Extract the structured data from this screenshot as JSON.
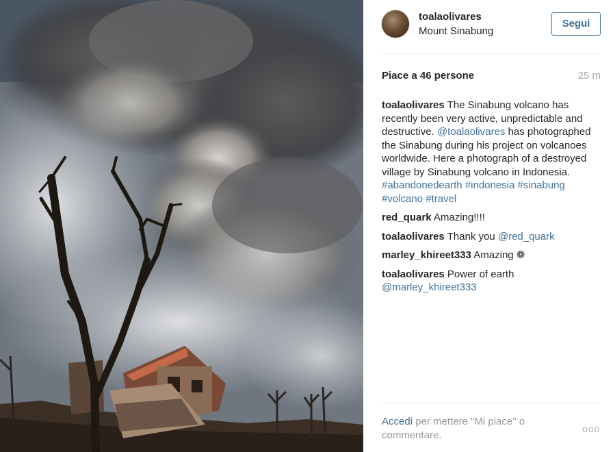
{
  "post": {
    "username": "toalaolivares",
    "location": "Mount Sinabung",
    "follow_label": "Segui",
    "likes": "Piace a 46 persone",
    "time": "25 m"
  },
  "comments": [
    {
      "user": "toalaolivares",
      "parts": [
        {
          "t": "text",
          "v": "The Sinabung volcano has recently been very active, unpredictable and destructive. "
        },
        {
          "t": "link",
          "v": "@toalaolivares"
        },
        {
          "t": "text",
          "v": " has photographed the Sinabung during his project on volcanoes worldwide. Here a photograph of a destroyed village by Sinabung volcano in Indonesia. "
        },
        {
          "t": "link",
          "v": "#abandonedearth"
        },
        {
          "t": "text",
          "v": " "
        },
        {
          "t": "link",
          "v": "#indonesia"
        },
        {
          "t": "text",
          "v": " "
        },
        {
          "t": "link",
          "v": "#sinabung"
        },
        {
          "t": "text",
          "v": " "
        },
        {
          "t": "link",
          "v": "#volcano"
        },
        {
          "t": "text",
          "v": " "
        },
        {
          "t": "link",
          "v": "#travel"
        }
      ]
    },
    {
      "user": "red_quark",
      "parts": [
        {
          "t": "text",
          "v": "Amazing!!!!"
        }
      ]
    },
    {
      "user": "toalaolivares",
      "parts": [
        {
          "t": "text",
          "v": "Thank you "
        },
        {
          "t": "link",
          "v": "@red_quark"
        }
      ]
    },
    {
      "user": "marley_khireet333",
      "parts": [
        {
          "t": "text",
          "v": "Amazing ❁"
        }
      ]
    },
    {
      "user": "toalaolivares",
      "parts": [
        {
          "t": "text",
          "v": "Power of earth "
        },
        {
          "t": "link",
          "v": "@marley_khireet333"
        }
      ]
    }
  ],
  "footer": {
    "login_link": "Accedi",
    "login_text": " per mettere \"Mi piace\" o commentare.",
    "more_icon": "ellipsis-icon",
    "more_glyph": "ooo"
  },
  "colors": {
    "link": "#3f729b",
    "muted": "#a5a7aa"
  }
}
